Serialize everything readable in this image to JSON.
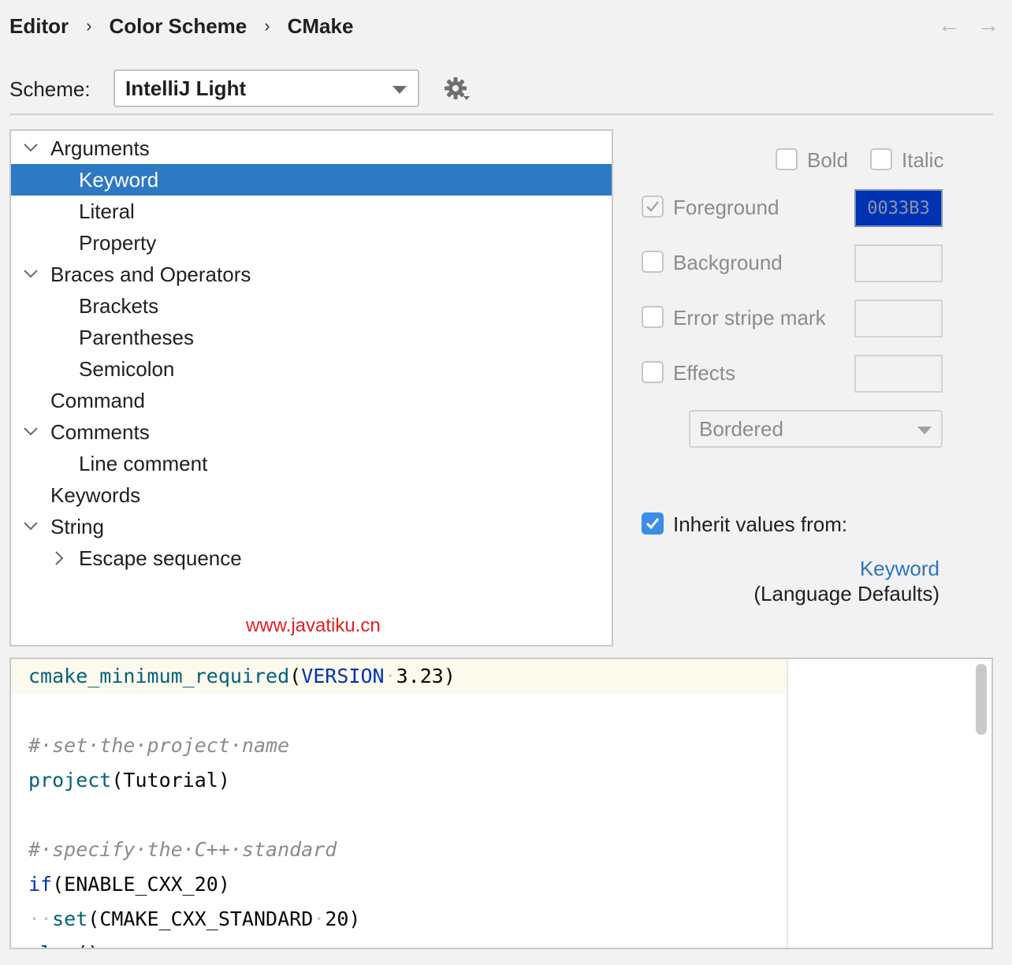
{
  "breadcrumb": [
    "Editor",
    "Color Scheme",
    "CMake"
  ],
  "scheme": {
    "label": "Scheme:",
    "value": "IntelliJ Light"
  },
  "tree": [
    {
      "label": "Arguments",
      "level": 0,
      "chevron": "expanded"
    },
    {
      "label": "Keyword",
      "level": 1,
      "selected": true
    },
    {
      "label": "Literal",
      "level": 1
    },
    {
      "label": "Property",
      "level": 1
    },
    {
      "label": "Braces and Operators",
      "level": 0,
      "chevron": "expanded"
    },
    {
      "label": "Brackets",
      "level": 1
    },
    {
      "label": "Parentheses",
      "level": 1
    },
    {
      "label": "Semicolon",
      "level": 1
    },
    {
      "label": "Command",
      "level": 0
    },
    {
      "label": "Comments",
      "level": 0,
      "chevron": "expanded"
    },
    {
      "label": "Line comment",
      "level": 1
    },
    {
      "label": "Keywords",
      "level": 0
    },
    {
      "label": "String",
      "level": 0,
      "chevron": "expanded"
    },
    {
      "label": "Escape sequence",
      "level": 1,
      "chevron": "collapsed"
    }
  ],
  "watermark": "www.javatiku.cn",
  "options": {
    "bold": "Bold",
    "italic": "Italic",
    "foreground": "Foreground",
    "foreground_value": "0033B3",
    "background": "Background",
    "error_stripe": "Error stripe mark",
    "effects": "Effects",
    "effects_type": "Bordered",
    "inherit": "Inherit values from:",
    "inherit_link": "Keyword",
    "inherit_sub": "(Language Defaults)"
  },
  "colors": {
    "selection": "#2d79c4",
    "foreground_swatch": "#0033B3",
    "command": "#00627A",
    "comment": "#8C8C8C",
    "link": "#2f74c0"
  },
  "code": [
    [
      {
        "t": "cmake_minimum_required",
        "c": "cmd"
      },
      {
        "t": "(",
        "c": ""
      },
      {
        "t": "VERSION",
        "c": "kw"
      },
      {
        "t": "·",
        "c": "ws"
      },
      {
        "t": "3.23)",
        "c": ""
      }
    ],
    [],
    [
      {
        "t": "#·set·the·project·name",
        "c": "cmt"
      }
    ],
    [
      {
        "t": "project",
        "c": "cmd"
      },
      {
        "t": "(Tutorial)",
        "c": ""
      }
    ],
    [],
    [
      {
        "t": "#·specify·the·C++·standard",
        "c": "cmt"
      }
    ],
    [
      {
        "t": "if",
        "c": "kw"
      },
      {
        "t": "(ENABLE_CXX_20)",
        "c": ""
      }
    ],
    [
      {
        "t": "··",
        "c": "ws"
      },
      {
        "t": "set",
        "c": "cmd"
      },
      {
        "t": "(CMAKE_CXX_STANDARD",
        "c": ""
      },
      {
        "t": "·",
        "c": "ws"
      },
      {
        "t": "20)",
        "c": ""
      }
    ],
    [
      {
        "t": "else",
        "c": "kw"
      },
      {
        "t": "()",
        "c": ""
      }
    ]
  ]
}
